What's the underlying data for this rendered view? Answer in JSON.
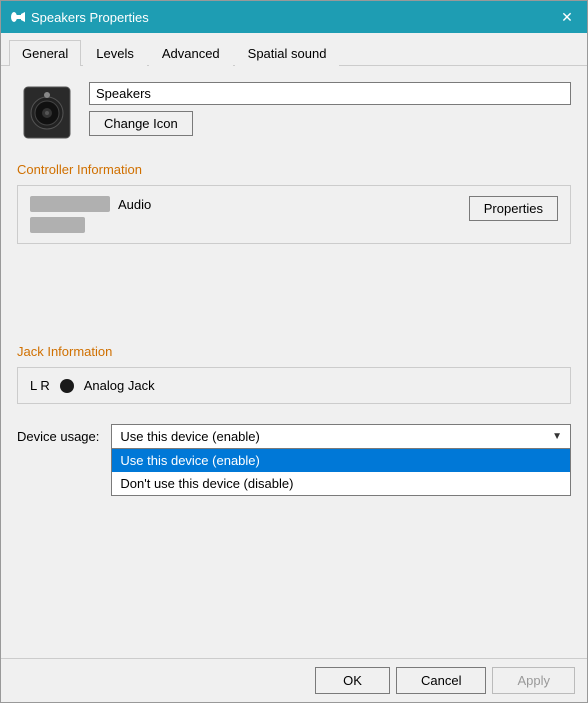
{
  "window": {
    "title": "Speakers Properties",
    "icon": "speaker"
  },
  "tabs": [
    {
      "id": "general",
      "label": "General",
      "active": true
    },
    {
      "id": "levels",
      "label": "Levels",
      "active": false
    },
    {
      "id": "advanced",
      "label": "Advanced",
      "active": false
    },
    {
      "id": "spatial",
      "label": "Spatial sound",
      "active": false
    }
  ],
  "general": {
    "device_name": "Speakers",
    "change_icon_label": "Change Icon",
    "controller_section_label": "Controller Information",
    "audio_label": "Audio",
    "properties_btn_label": "Properties",
    "jack_section_label": "Jack Information",
    "lr_label": "L R",
    "analog_jack_label": "Analog Jack",
    "device_usage_label": "Device usage:",
    "device_usage_selected": "Use this device (enable)",
    "device_usage_options": [
      "Use this device (enable)",
      "Don't use this device (disable)"
    ],
    "dropdown_arrow": "▼"
  },
  "footer": {
    "ok_label": "OK",
    "cancel_label": "Cancel",
    "apply_label": "Apply"
  }
}
